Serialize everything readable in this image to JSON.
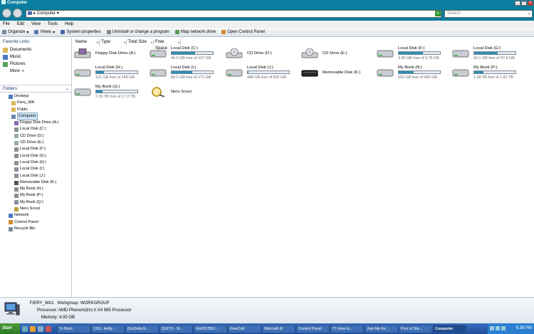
{
  "window": {
    "title": "Computer"
  },
  "address": {
    "path": "Computer",
    "search_placeholder": "Search"
  },
  "menu": [
    "File",
    "Edit",
    "View",
    "Tools",
    "Help"
  ],
  "toolbar": [
    "Organize",
    "Views",
    "System properties",
    "Uninstall or change a program",
    "Map network drive",
    "Open Control Panel"
  ],
  "favorites": {
    "header": "Favorite Links",
    "items": [
      "Documents",
      "Music",
      "Pictures"
    ],
    "more": "More"
  },
  "folders": {
    "header": "Folders",
    "tree": [
      "Desktop",
      "Fiery_WA",
      "Public",
      "Computer",
      "Floppy Disk Drive (A:)",
      "Local Disk (C:)",
      "CD Drive (D:)",
      "CD Drive (E:)",
      "Local Disk (F:)",
      "Local Disk (G:)",
      "Local Disk (H:)",
      "Local Disk (I:)",
      "Local Disk (J:)",
      "Removable Disk (K:)",
      "My Book (N:)",
      "My Book (P:)",
      "My Book (Q:)",
      "Nero Scout",
      "Network",
      "Control Panel",
      "Recycle Bin"
    ]
  },
  "columns": [
    "Name",
    "Type",
    "Total Size",
    "Free Space"
  ],
  "drives": [
    {
      "name": "Floppy Disk Drive (A:)",
      "icon": "floppy-icon",
      "free": "",
      "used_fraction": null
    },
    {
      "name": "Local Disk (C:)",
      "icon": "hard-disk-icon",
      "free": "46.0 GB free of 107 GB",
      "used_fraction": 0.57
    },
    {
      "name": "CD Drive (D:)",
      "icon": "cd-drive-icon",
      "free": "",
      "used_fraction": null
    },
    {
      "name": "CD Drive (E:)",
      "icon": "cd-drive-icon",
      "free": "",
      "used_fraction": null
    },
    {
      "name": "Local Disk (F:)",
      "icon": "hard-disk-icon",
      "free": "3.96 GB free of 9.75 GB",
      "used_fraction": 0.59
    },
    {
      "name": "Local Disk (G:)",
      "icon": "hard-disk-icon",
      "free": "42.1 GB free of 97.6 GB",
      "used_fraction": 0.57
    },
    {
      "name": "Local Disk (H:)",
      "icon": "hard-disk-icon",
      "free": "121 GB free of 149 GB",
      "used_fraction": 0.19
    },
    {
      "name": "Local Disk (I:)",
      "icon": "hard-disk-icon",
      "free": "85.0 GB free of 171 GB",
      "used_fraction": 0.5
    },
    {
      "name": "Local Disk (J:)",
      "icon": "hard-disk-icon",
      "free": "498 GB free of 502 GB",
      "used_fraction": 0.01
    },
    {
      "name": "Removable Disk (K:)",
      "icon": "removable-disk-icon",
      "free": "",
      "used_fraction": null
    },
    {
      "name": "My Book (N:)",
      "icon": "hard-disk-icon",
      "free": "593 GB free of 930 GB",
      "used_fraction": 0.36
    },
    {
      "name": "My Book (P:)",
      "icon": "hard-disk-icon",
      "free": "1.39 TB free of 1.81 TB",
      "used_fraction": 0.23
    },
    {
      "name": "My Book (Q:)",
      "icon": "hard-disk-icon",
      "free": "2.29 TB free of 2.72 TB",
      "used_fraction": 0.16
    },
    {
      "name": "Nero Scout",
      "icon": "nero-scout-icon",
      "free": "",
      "used_fraction": null
    }
  ],
  "details": {
    "name": "FIERY_WA1",
    "workgroup_label": "Workgroup:",
    "workgroup": "WORKGROUP",
    "processor_label": "Processor:",
    "processor": "AMD Phenom(tm) II X4 965 Processor",
    "memory_label": "Memory:",
    "memory": "4.00 GB"
  },
  "taskbar": {
    "start": "Start",
    "tasks": [
      "To Burn",
      "1151. Holly...",
      "[GoDoEsS...",
      "QUITS - N...",
      "GHOSTBO...",
      "FreeCell",
      "Warcraft III",
      "Control Panel",
      "IT: How to...",
      "Join Me for...",
      "Pics of Ste...",
      "Computer"
    ],
    "active_task": "Computer",
    "clock": "6:38 PM"
  },
  "colors": {
    "title_bar": "#0a7ea0",
    "address_bar": "#0b7d9e",
    "usage_bar": "#2f8fb4",
    "taskbar": "#1f4d9a"
  }
}
